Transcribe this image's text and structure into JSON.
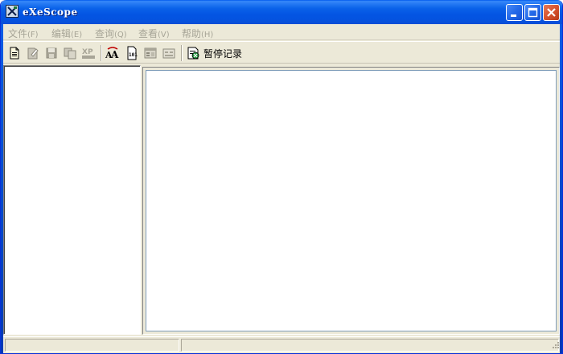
{
  "window": {
    "title": "eXeScope"
  },
  "menubar": {
    "items": [
      {
        "label": "文件",
        "accel": "(F)"
      },
      {
        "label": "编辑",
        "accel": "(E)"
      },
      {
        "label": "查询",
        "accel": "(Q)"
      },
      {
        "label": "查看",
        "accel": "(V)"
      },
      {
        "label": "帮助",
        "accel": "(H)"
      }
    ]
  },
  "toolbar": {
    "buttons": [
      {
        "icon": "open-file-icon",
        "enabled": true
      },
      {
        "icon": "edit-icon",
        "enabled": false
      },
      {
        "icon": "save-icon",
        "enabled": false
      },
      {
        "icon": "copy-icon",
        "enabled": false
      },
      {
        "icon": "xp-icon",
        "enabled": false
      },
      {
        "icon": "font-icon",
        "enabled": true
      },
      {
        "icon": "binary-icon",
        "enabled": true
      },
      {
        "icon": "dialog-icon",
        "enabled": false
      },
      {
        "icon": "form-icon",
        "enabled": false
      }
    ],
    "pause_label": "暂停记录"
  },
  "colors": {
    "titlebar": "#0a62e9",
    "window_bg": "#ece9d8",
    "menu_disabled_text": "#a7a597",
    "close_button": "#d7532e"
  },
  "statusbar": {
    "panel1": "",
    "panel2": ""
  }
}
